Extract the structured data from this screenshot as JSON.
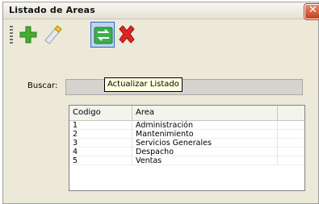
{
  "window": {
    "title": "Listado de Areas"
  },
  "toolbar": {
    "buttons": [
      {
        "name": "add",
        "icon": "plus-icon"
      },
      {
        "name": "edit",
        "icon": "pencil-icon"
      },
      {
        "name": "refresh",
        "icon": "refresh-list-icon"
      },
      {
        "name": "delete",
        "icon": "delete-x-icon"
      }
    ],
    "tooltip": "Actualizar Listado"
  },
  "search": {
    "label": "Buscar:",
    "value": ""
  },
  "table": {
    "columns": [
      "Codigo",
      "Area",
      ""
    ],
    "rows": [
      {
        "codigo": "1",
        "area": "Administración"
      },
      {
        "codigo": "2",
        "area": "Mantenimiento"
      },
      {
        "codigo": "3",
        "area": "Servicios Generales"
      },
      {
        "codigo": "4",
        "area": "Despacho"
      },
      {
        "codigo": "5",
        "area": "Ventas"
      }
    ]
  },
  "colors": {
    "accent": "#316ac5",
    "add": "#3fa52a",
    "delete": "#e02424"
  }
}
